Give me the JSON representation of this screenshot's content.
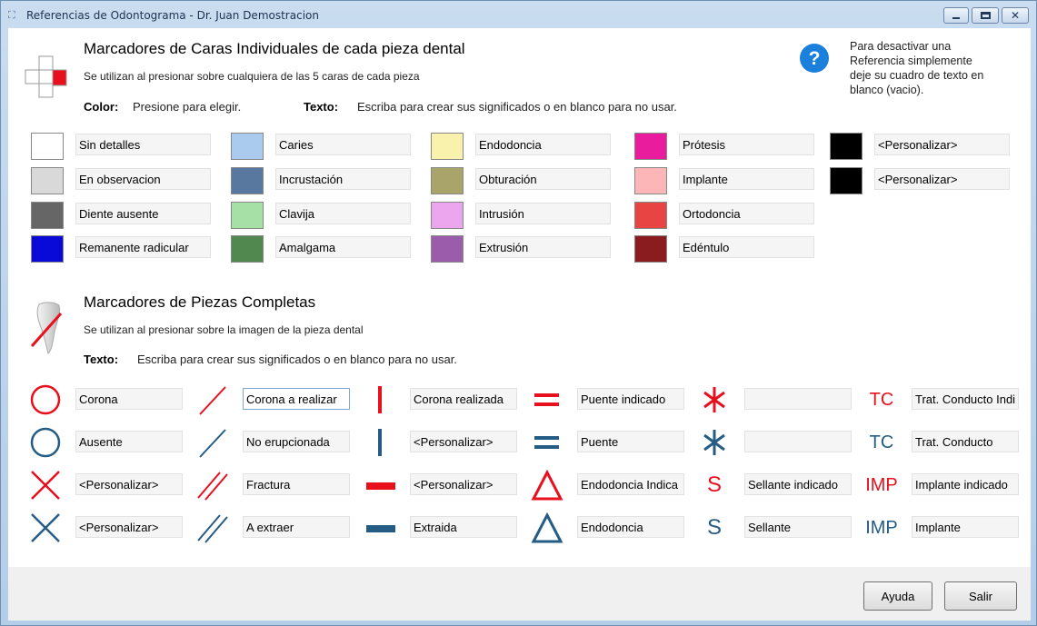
{
  "window": {
    "title": "Referencias de Odontograma - Dr. Juan Demostracion"
  },
  "colors": {
    "red": "#e8101c",
    "blue": "#245c86",
    "title_blue": "#1e3250"
  },
  "section1": {
    "title": "Marcadores de Caras Individuales de cada pieza dental",
    "subtitle": "Se utilizan al presionar sobre cualquiera de las 5 caras de cada pieza",
    "color_label": "Color:",
    "color_hint": "Presione para elegir.",
    "text_label": "Texto:",
    "text_hint": "Escriba para crear sus significados o en blanco para no usar.",
    "help_text": [
      "Para desactivar una",
      "Referencia simplemente",
      "deje su cuadro de texto en",
      "blanco (vacio)."
    ]
  },
  "faces": [
    {
      "color": "#ffffff",
      "label": "Sin detalles"
    },
    {
      "color": "#d9d9d9",
      "label": "En observacion"
    },
    {
      "color": "#666666",
      "label": "Diente ausente"
    },
    {
      "color": "#0a0ad8",
      "label": "Remanente radicular"
    },
    {
      "color": "#aacaee",
      "label": "Caries"
    },
    {
      "color": "#5878a0",
      "label": "Incrustación"
    },
    {
      "color": "#a6e0a6",
      "label": "Clavija"
    },
    {
      "color": "#508850",
      "label": "Amalgama"
    },
    {
      "color": "#f8f2ac",
      "label": "Endodoncia"
    },
    {
      "color": "#a8a46a",
      "label": "Obturación"
    },
    {
      "color": "#eca6ee",
      "label": "Intrusión"
    },
    {
      "color": "#9c5cac",
      "label": "Extrusión"
    },
    {
      "color": "#e81c9c",
      "label": "Prótesis"
    },
    {
      "color": "#fcb6b8",
      "label": "Implante"
    },
    {
      "color": "#e84444",
      "label": "Ortodoncia"
    },
    {
      "color": "#8a1c20",
      "label": "Edéntulo"
    },
    {
      "color": "#000000",
      "label": "<Personalizar>"
    },
    {
      "color": "#000000",
      "label": "<Personalizar>"
    }
  ],
  "section2": {
    "title": "Marcadores de Piezas Completas",
    "subtitle": "Se utilizan al presionar sobre la imagen de la pieza dental",
    "text_label": "Texto:",
    "text_hint": "Escriba para crear sus significados o en blanco para no usar."
  },
  "pieces": [
    {
      "icon": "circle-red",
      "label": "Corona"
    },
    {
      "icon": "circle-blue",
      "label": "Ausente"
    },
    {
      "icon": "x-red",
      "label": "<Personalizar>"
    },
    {
      "icon": "x-blue",
      "label": "<Personalizar>"
    },
    {
      "icon": "slash-red",
      "label": "Corona a realizar"
    },
    {
      "icon": "slash-blue",
      "label": "No erupcionada"
    },
    {
      "icon": "double-slash-red",
      "label": "Fractura"
    },
    {
      "icon": "double-slash-blue",
      "label": "A extraer"
    },
    {
      "icon": "vbar-red",
      "label": "Corona realizada"
    },
    {
      "icon": "vbar-blue",
      "label": "<Personalizar>"
    },
    {
      "icon": "hbar-red",
      "label": "<Personalizar>"
    },
    {
      "icon": "hbar-blue",
      "label": "Extraida"
    },
    {
      "icon": "equals-red",
      "label": "Puente indicado"
    },
    {
      "icon": "equals-blue",
      "label": "Puente"
    },
    {
      "icon": "triangle-red",
      "label": "Endodoncia Indica"
    },
    {
      "icon": "triangle-blue",
      "label": "Endodoncia"
    },
    {
      "icon": "asterisk-red",
      "label": ""
    },
    {
      "icon": "asterisk-blue",
      "label": ""
    },
    {
      "icon": "s-red",
      "label": "Sellante indicado",
      "glyph": "S"
    },
    {
      "icon": "s-blue",
      "label": "Sellante",
      "glyph": "S"
    },
    {
      "icon": "tc-red",
      "label": "Trat. Conducto Indi",
      "glyph": "TC"
    },
    {
      "icon": "tc-blue",
      "label": "Trat. Conducto",
      "glyph": "TC"
    },
    {
      "icon": "imp-red",
      "label": "Implante indicado",
      "glyph": "IMP"
    },
    {
      "icon": "imp-blue",
      "label": "Implante",
      "glyph": "IMP"
    }
  ],
  "buttons": {
    "help": "Ayuda",
    "exit": "Salir"
  }
}
